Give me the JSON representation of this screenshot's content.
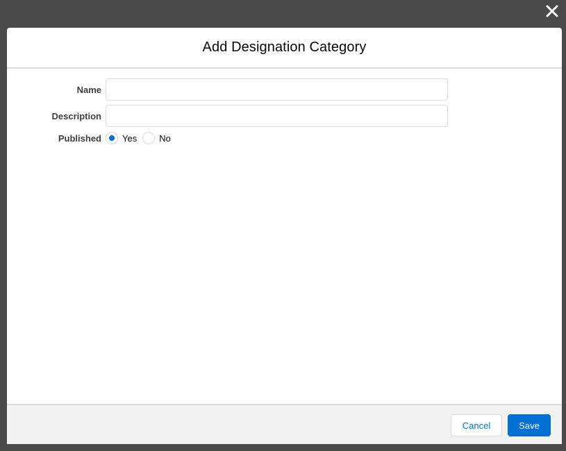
{
  "modal": {
    "title": "Add Designation Category"
  },
  "form": {
    "name": {
      "label": "Name",
      "value": "",
      "placeholder": ""
    },
    "description": {
      "label": "Description",
      "value": "",
      "placeholder": ""
    },
    "published": {
      "label": "Published",
      "options": [
        {
          "label": "Yes",
          "checked": true
        },
        {
          "label": "No",
          "checked": false
        }
      ]
    }
  },
  "footer": {
    "cancel_label": "Cancel",
    "save_label": "Save"
  },
  "icons": {
    "close": "close-icon"
  },
  "colors": {
    "accent": "#0070d2",
    "overlay": "#4a4a4a",
    "footer_bg": "#f3f2f2",
    "border": "#dddbda"
  }
}
